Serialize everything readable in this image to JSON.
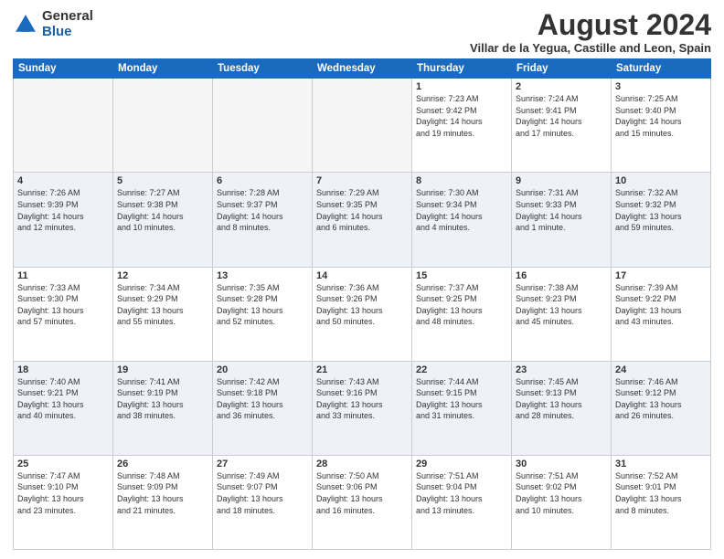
{
  "logo": {
    "general": "General",
    "blue": "Blue"
  },
  "title": "August 2024",
  "location": "Villar de la Yegua, Castille and Leon, Spain",
  "days_header": [
    "Sunday",
    "Monday",
    "Tuesday",
    "Wednesday",
    "Thursday",
    "Friday",
    "Saturday"
  ],
  "weeks": [
    [
      {
        "num": "",
        "info": "",
        "empty": true
      },
      {
        "num": "",
        "info": "",
        "empty": true
      },
      {
        "num": "",
        "info": "",
        "empty": true
      },
      {
        "num": "",
        "info": "",
        "empty": true
      },
      {
        "num": "1",
        "info": "Sunrise: 7:23 AM\nSunset: 9:42 PM\nDaylight: 14 hours\nand 19 minutes."
      },
      {
        "num": "2",
        "info": "Sunrise: 7:24 AM\nSunset: 9:41 PM\nDaylight: 14 hours\nand 17 minutes."
      },
      {
        "num": "3",
        "info": "Sunrise: 7:25 AM\nSunset: 9:40 PM\nDaylight: 14 hours\nand 15 minutes."
      }
    ],
    [
      {
        "num": "4",
        "info": "Sunrise: 7:26 AM\nSunset: 9:39 PM\nDaylight: 14 hours\nand 12 minutes."
      },
      {
        "num": "5",
        "info": "Sunrise: 7:27 AM\nSunset: 9:38 PM\nDaylight: 14 hours\nand 10 minutes."
      },
      {
        "num": "6",
        "info": "Sunrise: 7:28 AM\nSunset: 9:37 PM\nDaylight: 14 hours\nand 8 minutes."
      },
      {
        "num": "7",
        "info": "Sunrise: 7:29 AM\nSunset: 9:35 PM\nDaylight: 14 hours\nand 6 minutes."
      },
      {
        "num": "8",
        "info": "Sunrise: 7:30 AM\nSunset: 9:34 PM\nDaylight: 14 hours\nand 4 minutes."
      },
      {
        "num": "9",
        "info": "Sunrise: 7:31 AM\nSunset: 9:33 PM\nDaylight: 14 hours\nand 1 minute."
      },
      {
        "num": "10",
        "info": "Sunrise: 7:32 AM\nSunset: 9:32 PM\nDaylight: 13 hours\nand 59 minutes."
      }
    ],
    [
      {
        "num": "11",
        "info": "Sunrise: 7:33 AM\nSunset: 9:30 PM\nDaylight: 13 hours\nand 57 minutes."
      },
      {
        "num": "12",
        "info": "Sunrise: 7:34 AM\nSunset: 9:29 PM\nDaylight: 13 hours\nand 55 minutes."
      },
      {
        "num": "13",
        "info": "Sunrise: 7:35 AM\nSunset: 9:28 PM\nDaylight: 13 hours\nand 52 minutes."
      },
      {
        "num": "14",
        "info": "Sunrise: 7:36 AM\nSunset: 9:26 PM\nDaylight: 13 hours\nand 50 minutes."
      },
      {
        "num": "15",
        "info": "Sunrise: 7:37 AM\nSunset: 9:25 PM\nDaylight: 13 hours\nand 48 minutes."
      },
      {
        "num": "16",
        "info": "Sunrise: 7:38 AM\nSunset: 9:23 PM\nDaylight: 13 hours\nand 45 minutes."
      },
      {
        "num": "17",
        "info": "Sunrise: 7:39 AM\nSunset: 9:22 PM\nDaylight: 13 hours\nand 43 minutes."
      }
    ],
    [
      {
        "num": "18",
        "info": "Sunrise: 7:40 AM\nSunset: 9:21 PM\nDaylight: 13 hours\nand 40 minutes."
      },
      {
        "num": "19",
        "info": "Sunrise: 7:41 AM\nSunset: 9:19 PM\nDaylight: 13 hours\nand 38 minutes."
      },
      {
        "num": "20",
        "info": "Sunrise: 7:42 AM\nSunset: 9:18 PM\nDaylight: 13 hours\nand 36 minutes."
      },
      {
        "num": "21",
        "info": "Sunrise: 7:43 AM\nSunset: 9:16 PM\nDaylight: 13 hours\nand 33 minutes."
      },
      {
        "num": "22",
        "info": "Sunrise: 7:44 AM\nSunset: 9:15 PM\nDaylight: 13 hours\nand 31 minutes."
      },
      {
        "num": "23",
        "info": "Sunrise: 7:45 AM\nSunset: 9:13 PM\nDaylight: 13 hours\nand 28 minutes."
      },
      {
        "num": "24",
        "info": "Sunrise: 7:46 AM\nSunset: 9:12 PM\nDaylight: 13 hours\nand 26 minutes."
      }
    ],
    [
      {
        "num": "25",
        "info": "Sunrise: 7:47 AM\nSunset: 9:10 PM\nDaylight: 13 hours\nand 23 minutes."
      },
      {
        "num": "26",
        "info": "Sunrise: 7:48 AM\nSunset: 9:09 PM\nDaylight: 13 hours\nand 21 minutes."
      },
      {
        "num": "27",
        "info": "Sunrise: 7:49 AM\nSunset: 9:07 PM\nDaylight: 13 hours\nand 18 minutes."
      },
      {
        "num": "28",
        "info": "Sunrise: 7:50 AM\nSunset: 9:06 PM\nDaylight: 13 hours\nand 16 minutes."
      },
      {
        "num": "29",
        "info": "Sunrise: 7:51 AM\nSunset: 9:04 PM\nDaylight: 13 hours\nand 13 minutes."
      },
      {
        "num": "30",
        "info": "Sunrise: 7:51 AM\nSunset: 9:02 PM\nDaylight: 13 hours\nand 10 minutes."
      },
      {
        "num": "31",
        "info": "Sunrise: 7:52 AM\nSunset: 9:01 PM\nDaylight: 13 hours\nand 8 minutes."
      }
    ]
  ]
}
